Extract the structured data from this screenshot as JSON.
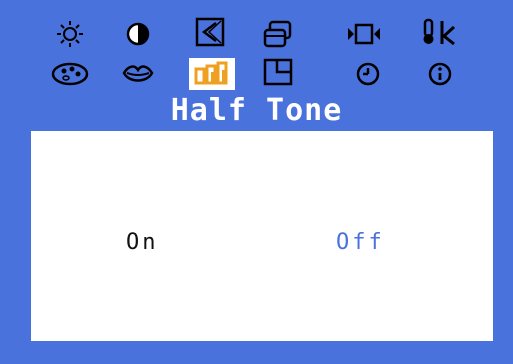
{
  "menu": {
    "title": "Half Tone",
    "selected_icon": "halftone-icon",
    "icons_row1": [
      "brightness-icon",
      "contrast-icon",
      "position-icon",
      "size-icon",
      "sharpness-icon",
      "color-temperature-icon"
    ],
    "icons_row2": [
      "color-palette-icon",
      "lips-icon",
      "halftone-icon",
      "window-icon",
      "clock-icon",
      "info-icon"
    ]
  },
  "options": {
    "on_label": "On",
    "off_label": "Off",
    "highlighted": "Off"
  },
  "colors": {
    "background": "#4a72dc",
    "panel": "#ffffff",
    "icon_selected_fill": "#f0a020",
    "text_dark": "#111111",
    "text_highlight": "#4a72dc"
  }
}
